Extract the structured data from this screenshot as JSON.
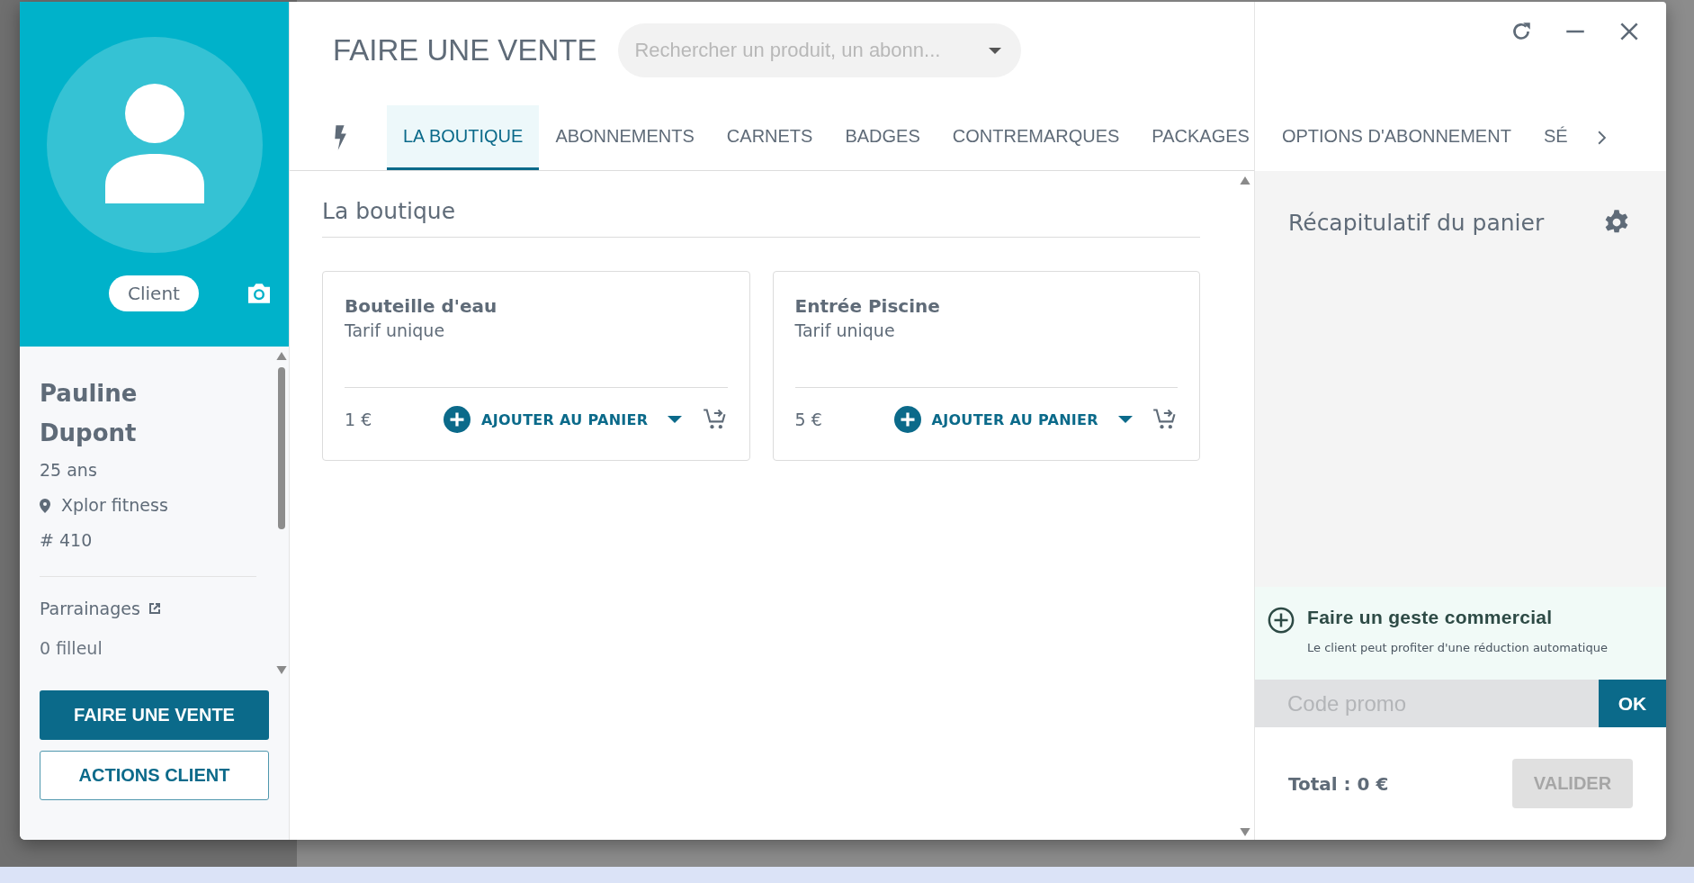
{
  "client": {
    "badge": "Client",
    "first_name": "Pauline",
    "last_name": "Dupont",
    "age": "25 ans",
    "location": "Xplor fitness",
    "number": "# 410",
    "referrals_label": "Parrainages",
    "referrals_count": "0 filleul"
  },
  "client_actions": [
    {
      "label": "FAIRE UNE VENTE",
      "kind": "primary"
    },
    {
      "label": "ACTIONS CLIENT",
      "kind": "outline"
    }
  ],
  "header": {
    "title": "FAIRE UNE VENTE",
    "search_placeholder": "Rechercher un produit, un abonn..."
  },
  "tabs": [
    {
      "label": "LA BOUTIQUE",
      "selected": true
    },
    {
      "label": "ABONNEMENTS",
      "selected": false
    },
    {
      "label": "CARNETS",
      "selected": false
    },
    {
      "label": "BADGES",
      "selected": false
    },
    {
      "label": "CONTREMARQUES",
      "selected": false
    },
    {
      "label": "PACKAGES",
      "selected": false
    },
    {
      "label": "OPTIONS D'ABONNEMENT",
      "selected": false
    },
    {
      "label": "SÉ",
      "selected": false
    }
  ],
  "section_title": "La boutique",
  "products": [
    {
      "name": "Bouteille d'eau",
      "tariff": "Tarif unique",
      "price": "1 €",
      "action": "AJOUTER AU PANIER"
    },
    {
      "name": "Entrée Piscine",
      "tariff": "Tarif unique",
      "price": "5 €",
      "action": "AJOUTER AU PANIER"
    }
  ],
  "cart": {
    "title": "Récapitulatif du panier",
    "gesture_title": "Faire un geste commercial",
    "gesture_note": "Le client peut profiter d'une réduction automatique",
    "promo_placeholder": "Code promo",
    "promo_button": "OK",
    "total": "Total : 0 €",
    "validate": {
      "label": "VALIDER",
      "disabled": true
    }
  }
}
